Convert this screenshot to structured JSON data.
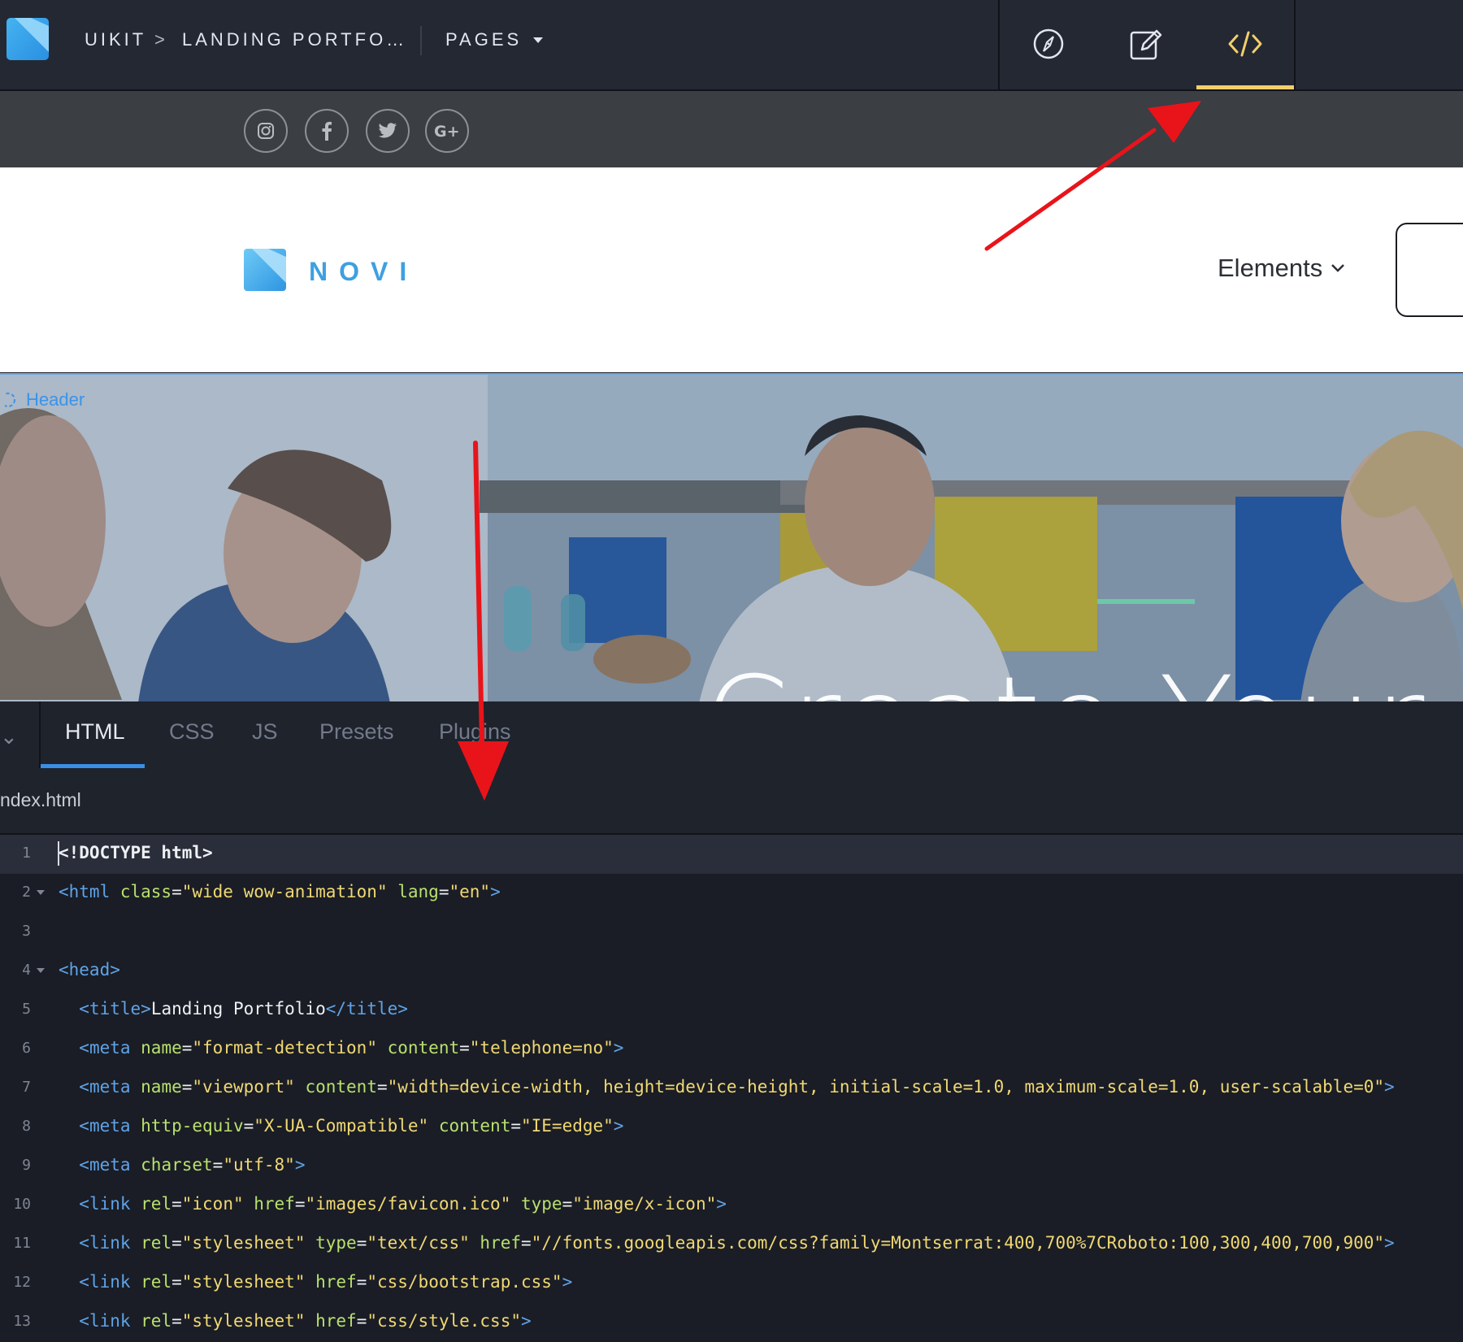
{
  "topbar": {
    "breadcrumb_root": "UIKIT",
    "breadcrumb_separator": ">",
    "breadcrumb_page": "LANDING PORTFO…",
    "pages_label": "PAGES",
    "active_tool_color": "#f2cf6b"
  },
  "social": {
    "items": [
      "instagram-icon",
      "facebook-icon",
      "twitter-icon",
      "google-plus-icon"
    ]
  },
  "header": {
    "logo_text": "NOVI",
    "menu_label": "Elements"
  },
  "hero": {
    "section_label": "Header",
    "title": "Create Your Webs"
  },
  "tabs": {
    "items": [
      "HTML",
      "CSS",
      "JS",
      "Presets",
      "Plugins"
    ],
    "active": "HTML"
  },
  "file": {
    "name": "ndex.html"
  },
  "code_lines": [
    {
      "n": "1",
      "text": "<!DOCTYPE html>"
    },
    {
      "n": "2",
      "text": "<html class=\"wide wow-animation\" lang=\"en\">"
    },
    {
      "n": "3",
      "text": ""
    },
    {
      "n": "4",
      "text": "<head>"
    },
    {
      "n": "5",
      "text": "  <title>Landing Portfolio</title>"
    },
    {
      "n": "6",
      "text": "  <meta name=\"format-detection\" content=\"telephone=no\">"
    },
    {
      "n": "7",
      "text": "  <meta name=\"viewport\" content=\"width=device-width, height=device-height, initial-scale=1.0, maximum-scale=1.0, user-scalable=0\">"
    },
    {
      "n": "8",
      "text": "  <meta http-equiv=\"X-UA-Compatible\" content=\"IE=edge\">"
    },
    {
      "n": "9",
      "text": "  <meta charset=\"utf-8\">"
    },
    {
      "n": "10",
      "text": "  <link rel=\"icon\" href=\"images/favicon.ico\" type=\"image/x-icon\">"
    },
    {
      "n": "11",
      "text": "  <link rel=\"stylesheet\" type=\"text/css\" href=\"//fonts.googleapis.com/css?family=Montserrat:400,700%7CRoboto:100,300,400,700,900\">"
    },
    {
      "n": "12",
      "text": "  <link rel=\"stylesheet\" href=\"css/bootstrap.css\">"
    },
    {
      "n": "13",
      "text": "  <link rel=\"stylesheet\" href=\"css/style.css\">"
    }
  ]
}
